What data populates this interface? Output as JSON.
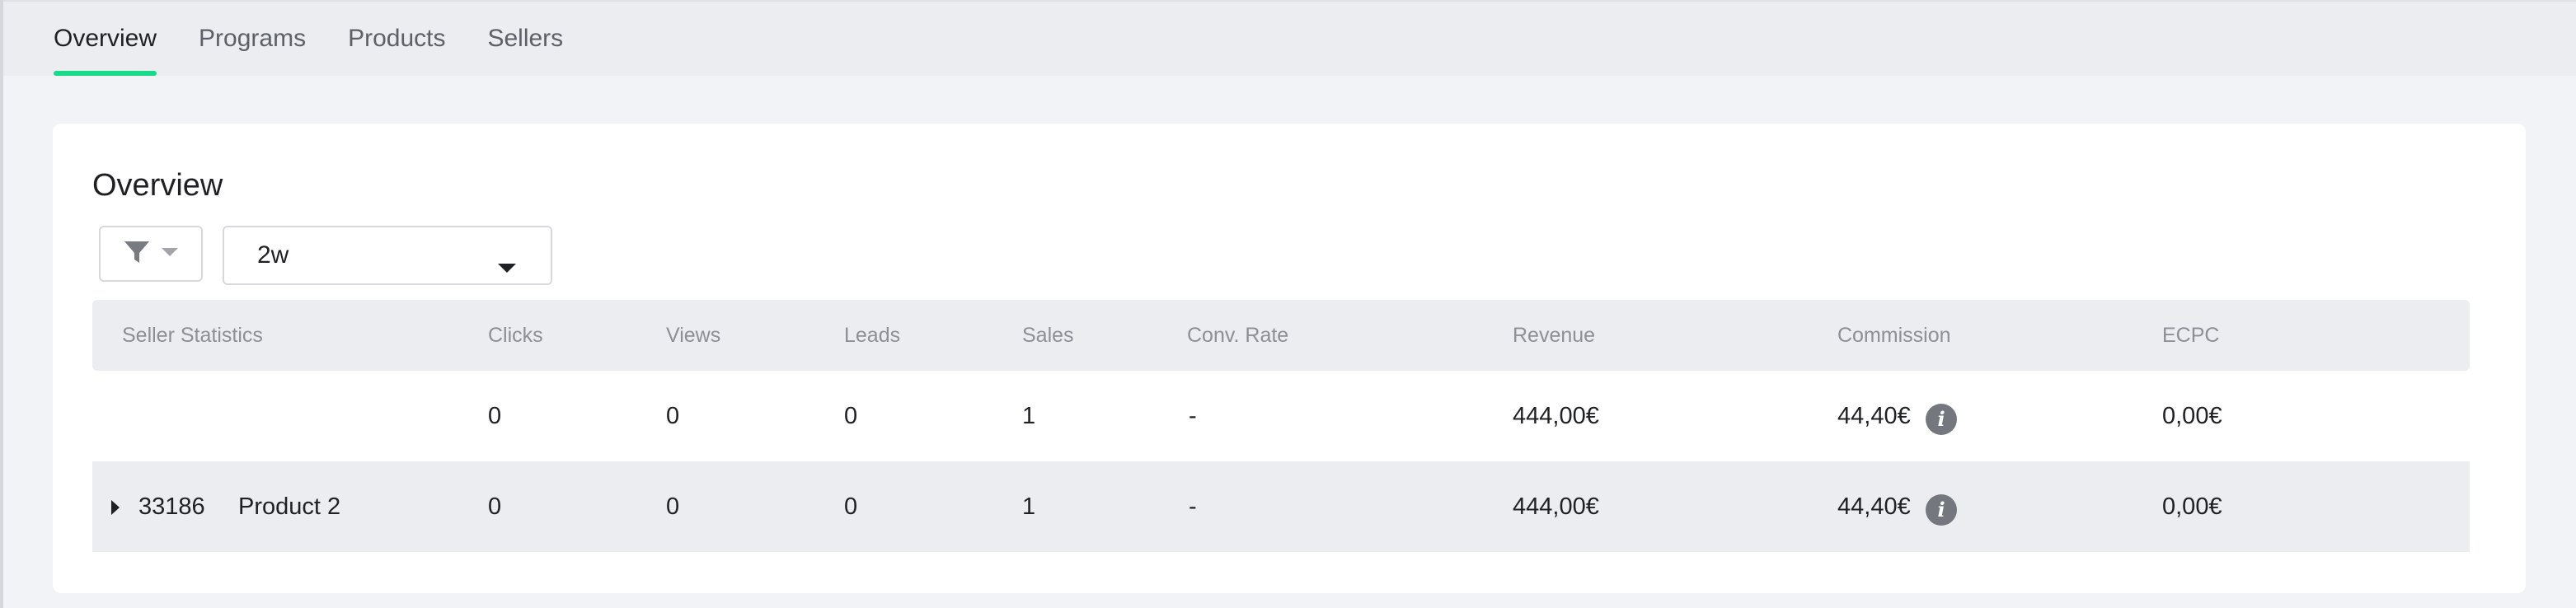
{
  "tabs": [
    {
      "label": "Overview",
      "active": true
    },
    {
      "label": "Programs",
      "active": false
    },
    {
      "label": "Products",
      "active": false
    },
    {
      "label": "Sellers",
      "active": false
    }
  ],
  "overview": {
    "title": "Overview",
    "filter_icon": "filter-icon",
    "period": {
      "value": "2w"
    }
  },
  "table": {
    "headers": [
      "Seller Statistics",
      "Clicks",
      "Views",
      "Leads",
      "Sales",
      "Conv. Rate",
      "Revenue",
      "Commission",
      "ECPC"
    ],
    "total_row": {
      "clicks": "0",
      "views": "0",
      "leads": "0",
      "sales": "1",
      "conv_rate": "-",
      "revenue": "444,00€",
      "commission": "44,40€",
      "ecpc": "0,00€"
    },
    "rows": [
      {
        "id": "33186",
        "name": "Product 2",
        "clicks": "0",
        "views": "0",
        "leads": "0",
        "sales": "1",
        "conv_rate": "-",
        "revenue": "444,00€",
        "commission": "44,40€",
        "ecpc": "0,00€"
      }
    ]
  },
  "colors": {
    "accent": "#19d98a",
    "header_bg": "#ecedf0",
    "info_icon": "#75777e"
  }
}
